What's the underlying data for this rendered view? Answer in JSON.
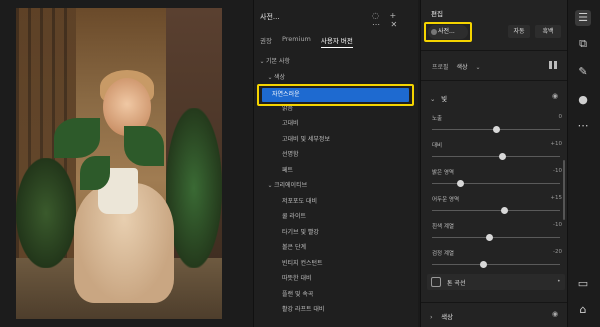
{
  "presets_panel": {
    "title": "사전...",
    "header_icons": "◌ + ⋯ ✕",
    "tabs": [
      {
        "label": "권장",
        "active": false
      },
      {
        "label": "Premium",
        "active": false
      },
      {
        "label": "사용자 버전",
        "active": true
      }
    ],
    "tree": [
      {
        "label": "기본 사항",
        "arrow": "⌄",
        "indent": 0
      },
      {
        "label": "색상",
        "arrow": "⌄",
        "indent": 1
      },
      {
        "label": "자연스러운",
        "arrow": "",
        "indent": 2,
        "selected": true
      },
      {
        "label": "밝음",
        "arrow": "",
        "indent": 2
      },
      {
        "label": "고대비",
        "arrow": "",
        "indent": 2
      },
      {
        "label": "고대비 및 세부정보",
        "arrow": "",
        "indent": 2
      },
      {
        "label": "선명함",
        "arrow": "",
        "indent": 2
      },
      {
        "label": "페트",
        "arrow": "",
        "indent": 2
      },
      {
        "label": "크리에이티브",
        "arrow": "⌄",
        "indent": 1
      },
      {
        "label": "저포포도 대비",
        "arrow": "",
        "indent": 2
      },
      {
        "label": "쿨 라이트",
        "arrow": "",
        "indent": 2
      },
      {
        "label": "타기브 및 빨강",
        "arrow": "",
        "indent": 2
      },
      {
        "label": "볼은 단계",
        "arrow": "",
        "indent": 2
      },
      {
        "label": "빈티지 컨스턴트",
        "arrow": "",
        "indent": 2
      },
      {
        "label": "따뜻한 대비",
        "arrow": "",
        "indent": 2
      },
      {
        "label": "플랜 및 속곡",
        "arrow": "",
        "indent": 2
      },
      {
        "label": "활강 라프트 대비",
        "arrow": "",
        "indent": 2
      }
    ]
  },
  "edit_panel": {
    "title": "편집",
    "preset_button": "사전...",
    "auto_button": "자동",
    "bw_button": "흑백",
    "profile_label": "프로필",
    "profile_value": "색상",
    "light_section": "빛",
    "sliders": [
      {
        "label": "노출",
        "value": "0",
        "pos": 0.5
      },
      {
        "label": "대비",
        "value": "+10",
        "pos": 0.55
      },
      {
        "label": "밝은 영역",
        "value": "-10",
        "pos": 0.22
      },
      {
        "label": "어두운 영역",
        "value": "+15",
        "pos": 0.57
      },
      {
        "label": "흰색 계열",
        "value": "-10",
        "pos": 0.45
      },
      {
        "label": "검정 계열",
        "value": "-20",
        "pos": 0.4
      }
    ],
    "curve_label": "톤 곡선",
    "color_section": "색상"
  },
  "toolbar": {
    "tools": [
      {
        "icon": "sliders-icon",
        "glyph": "☰",
        "active": true
      },
      {
        "icon": "crop-icon",
        "glyph": "⧉",
        "active": false
      },
      {
        "icon": "healing-icon",
        "glyph": "✎",
        "active": false
      },
      {
        "icon": "mask-icon",
        "glyph": "●",
        "active": false
      },
      {
        "icon": "more-icon",
        "glyph": "⋯",
        "active": false
      },
      {
        "icon": "comment-icon",
        "glyph": "▭",
        "active": false
      },
      {
        "icon": "tag-icon",
        "glyph": "⌂",
        "active": false
      }
    ]
  },
  "colors": {
    "accent": "#1e6ad0",
    "highlight": "#f5d400"
  }
}
